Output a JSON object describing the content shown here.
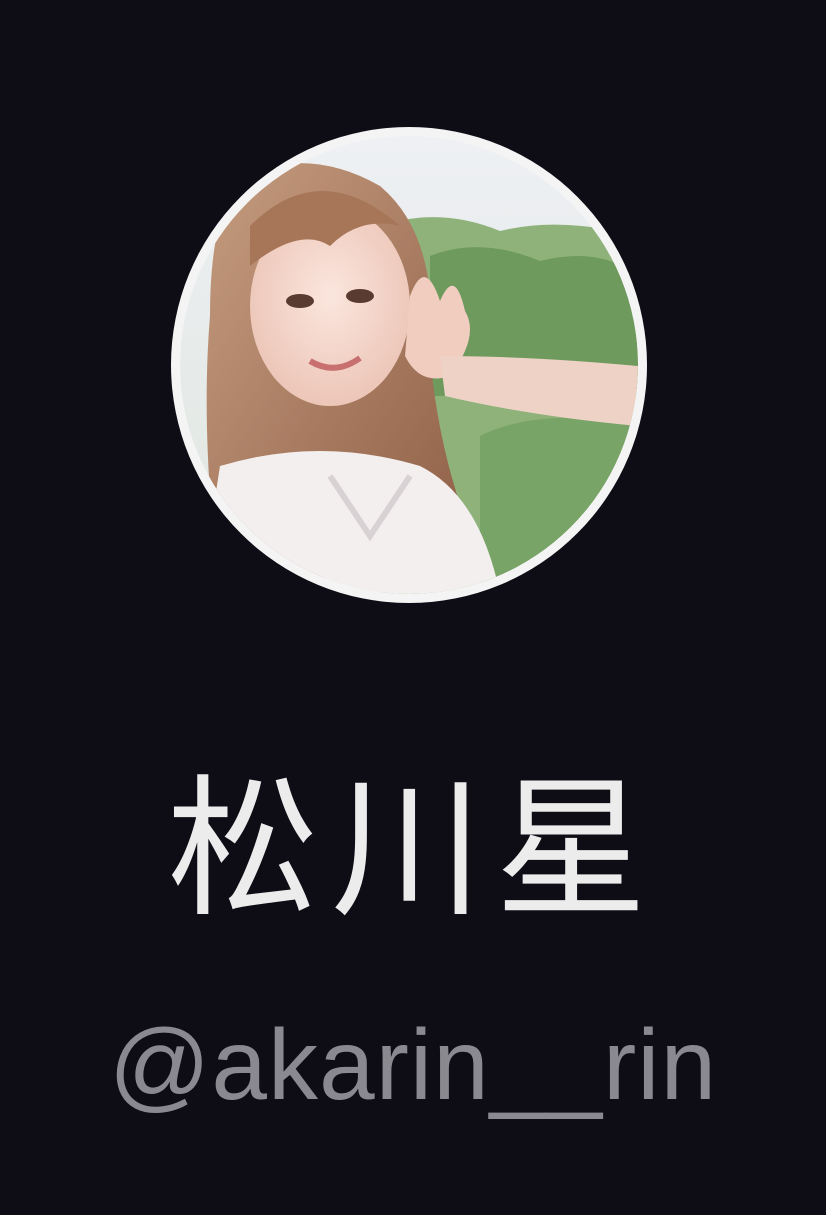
{
  "profile": {
    "avatar_icon": "profile-photo",
    "display_name": "松川星",
    "username": "@akarin__rin"
  }
}
